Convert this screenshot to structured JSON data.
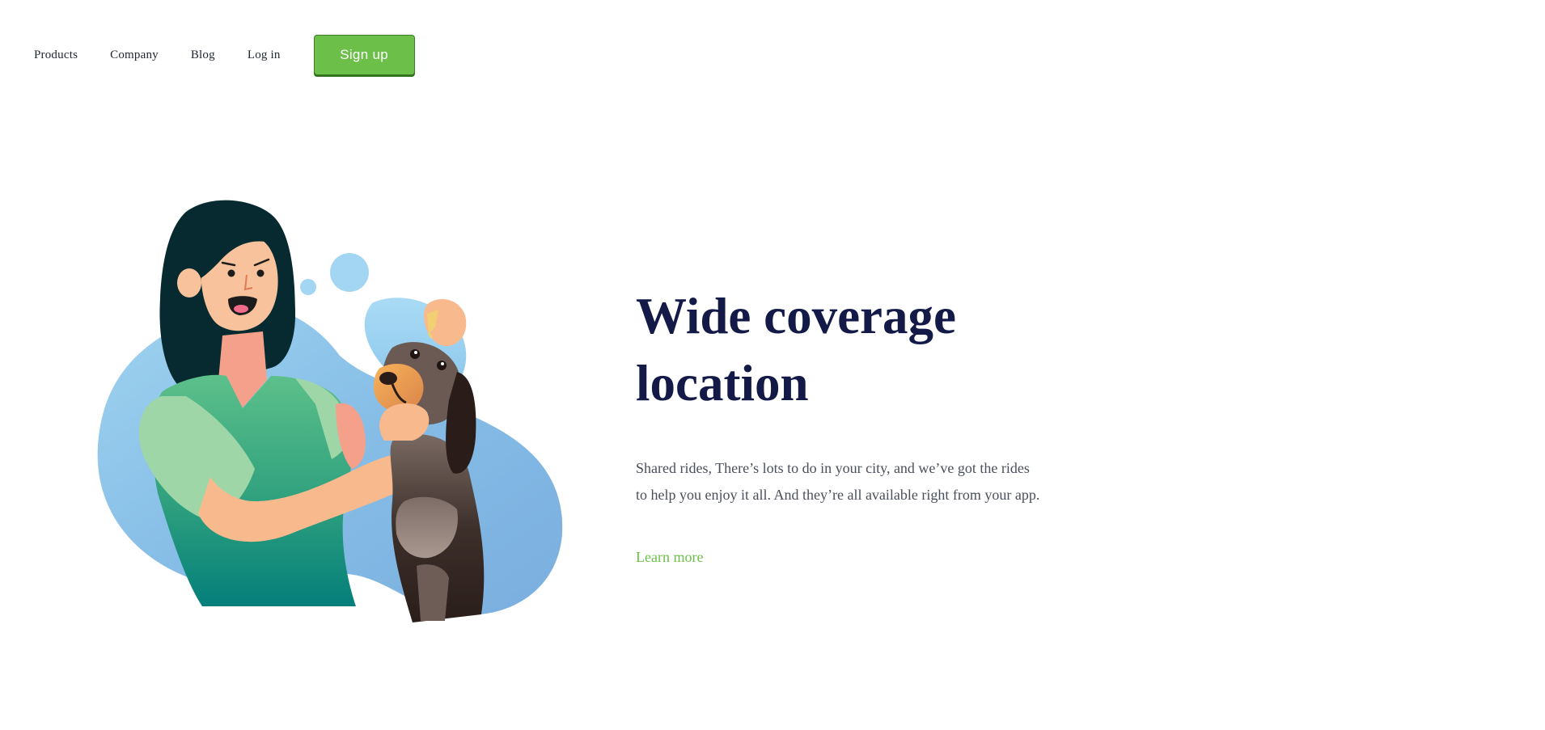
{
  "nav": {
    "items": [
      {
        "label": "Products"
      },
      {
        "label": "Company"
      },
      {
        "label": "Blog"
      },
      {
        "label": "Log in"
      }
    ],
    "signup_label": "Sign up"
  },
  "hero": {
    "title": "Wide coverage location",
    "description": "Shared rides, There’s lots to do in your city, and we’ve got the rides to help you enjoy it all. And they’re all available right from your app.",
    "cta_label": "Learn more"
  },
  "colors": {
    "accent_green": "#6cc04a",
    "heading_navy": "#141a47",
    "body_text": "#4a4f5c"
  }
}
